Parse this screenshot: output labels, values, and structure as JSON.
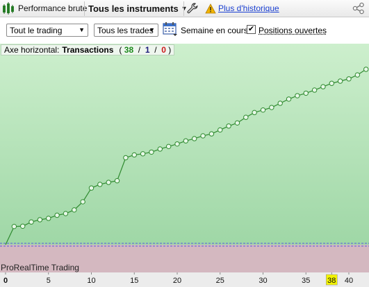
{
  "toolbar": {
    "performance_label": "Performance brute",
    "instruments_label": "Tous les instruments",
    "history_link": "Plus d'historique",
    "icons": [
      "performance-icon",
      "chevron-down-icon",
      "wrench-icon",
      "warning-icon",
      "share-icon"
    ]
  },
  "filters": {
    "trading_select": "Tout le trading",
    "trades_select": "Tous les trades",
    "week_label": "Semaine en cours",
    "open_positions_label": "Positions ouvertes",
    "open_positions_checked": true
  },
  "chart": {
    "axis_prefix": "Axe horizontal:",
    "axis_name": "Transactions",
    "ratio_open": "(",
    "ratio_wins": "38",
    "ratio_sep1": " / ",
    "ratio_even": "1",
    "ratio_sep2": " / ",
    "ratio_losses": "0",
    "ratio_close": ")",
    "brand": "ProRealTime Trading",
    "highlighted_tick": "38",
    "colors": {
      "gain_fill": "#c8ecc8",
      "loss_fill": "#d4b8c0",
      "line": "#2f8a2f",
      "marker_fill": "#e8f8e8",
      "zero_line": "#5a5ae0",
      "highlight_tick": "#f3f300"
    }
  },
  "chart_data": {
    "type": "line",
    "title": "",
    "xlabel": "Transactions",
    "ylabel": "",
    "xlim": [
      0,
      41
    ],
    "x_ticks": [
      0,
      5,
      10,
      15,
      20,
      25,
      30,
      35,
      38,
      40
    ],
    "grid": false,
    "series": [
      {
        "values": [
          0,
          6.5,
          6.6,
          8.1,
          8.9,
          9.4,
          10.5,
          11.1,
          12.4,
          15.3,
          20.2,
          21.5,
          22.2,
          22.8,
          31.0,
          32.0,
          32.4,
          33.0,
          34.1,
          35.0,
          35.9,
          37.0,
          37.8,
          38.8,
          39.5,
          40.9,
          42.3,
          43.4,
          45.4,
          47.1,
          48.0,
          48.9,
          50.4,
          51.9,
          53.1,
          54.0,
          55.1,
          56.3,
          57.5,
          58.3,
          59.1,
          60.5,
          62.5
        ],
        "x": [
          0,
          1,
          2,
          3,
          4,
          5,
          6,
          7,
          8,
          9,
          10,
          11,
          12,
          13,
          14,
          15,
          16,
          17,
          18,
          19,
          20,
          21,
          22,
          23,
          24,
          25,
          26,
          27,
          28,
          29,
          30,
          31,
          32,
          33,
          34,
          35,
          36,
          37,
          38,
          39,
          40,
          41,
          42
        ]
      }
    ]
  }
}
